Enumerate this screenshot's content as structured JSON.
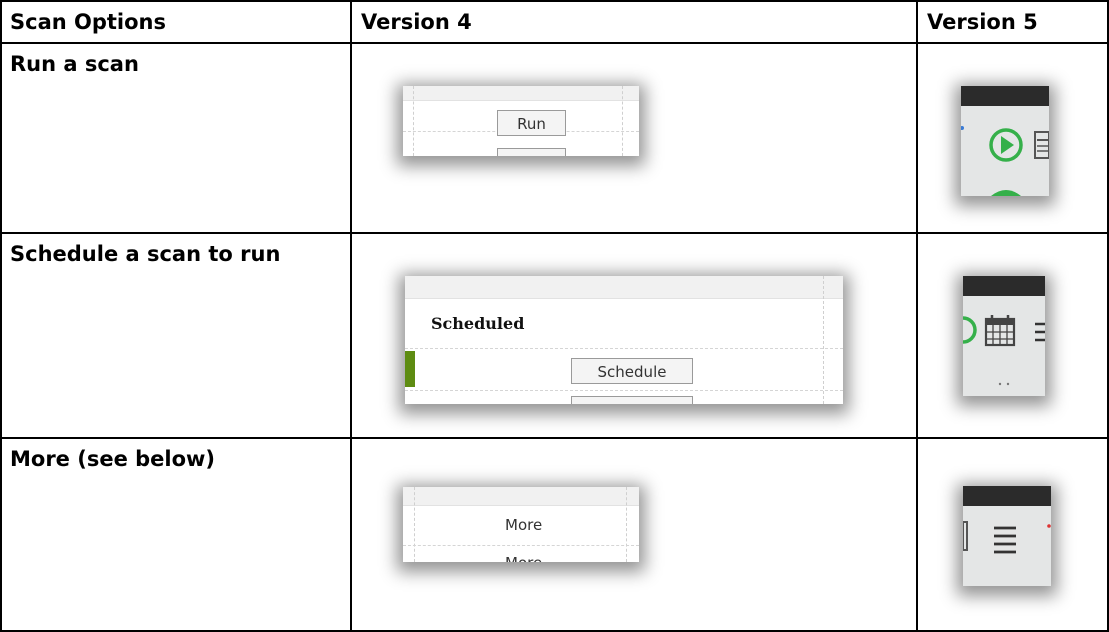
{
  "table": {
    "headers": [
      "Scan Options",
      "Version 4",
      "Version 5"
    ],
    "rows": [
      {
        "label": "Run a scan",
        "v4_button": "Run"
      },
      {
        "label": "Schedule a scan to run",
        "v4_section": "Scheduled",
        "v4_button": "Schedule"
      },
      {
        "label": "More (see below)",
        "v4_button": "More",
        "v4_button_cut": "More"
      }
    ]
  },
  "icons": {
    "run": "play-circle-icon",
    "schedule": "calendar-icon",
    "more": "hamburger-menu-icon"
  },
  "colors": {
    "v5_header": "#2b2b2b",
    "v5_body": "#e4e6e6",
    "play_green": "#35b04a",
    "v4_accent_green": "#5e8c12"
  }
}
